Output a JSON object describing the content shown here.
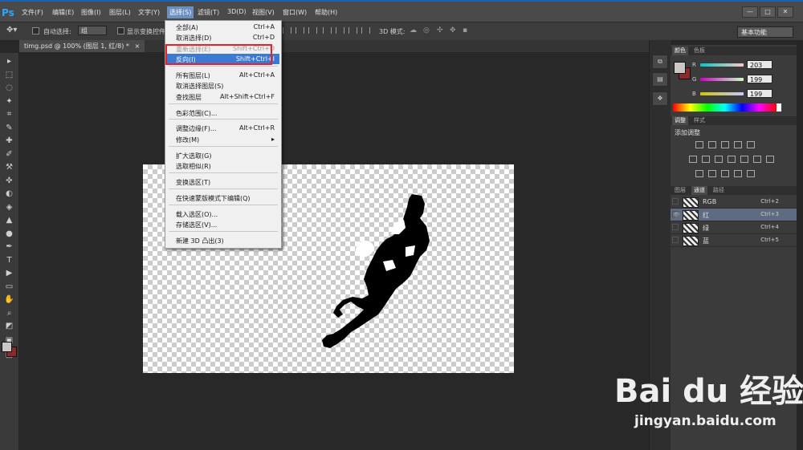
{
  "app": {
    "logo": "Ps"
  },
  "menubar": [
    "文件(F)",
    "编辑(E)",
    "图像(I)",
    "图层(L)",
    "文字(Y)",
    "选择(S)",
    "滤镜(T)",
    "3D(D)",
    "视图(V)",
    "窗口(W)",
    "帮助(H)"
  ],
  "window_controls": {
    "minimize": "—",
    "restore": "□",
    "close": "✕"
  },
  "options_bar": {
    "auto_select_label": "自动选择:",
    "auto_select_value": "组",
    "show_transform_label": "显示变换控件",
    "mode_3d_label": "3D 模式:",
    "workspace": "基本功能"
  },
  "document": {
    "tab_title": "timg.psd @ 100% (图层 1, 红/8) *",
    "tab_close": "×"
  },
  "select_menu": {
    "items": [
      {
        "label": "全部(A)",
        "shortcut": "Ctrl+A",
        "state": "normal"
      },
      {
        "label": "取消选择(D)",
        "shortcut": "Ctrl+D",
        "state": "normal"
      },
      {
        "label": "重新选择(E)",
        "shortcut": "Shift+Ctrl+D",
        "state": "disabled"
      },
      {
        "label": "反向(I)",
        "shortcut": "Shift+Ctrl+I",
        "state": "selected"
      },
      {
        "label": "所有图层(L)",
        "shortcut": "Alt+Ctrl+A",
        "state": "normal"
      },
      {
        "label": "取消选择图层(S)",
        "shortcut": "",
        "state": "normal"
      },
      {
        "label": "查找图层",
        "shortcut": "Alt+Shift+Ctrl+F",
        "state": "normal"
      },
      {
        "label": "色彩范围(C)...",
        "shortcut": "",
        "state": "normal"
      },
      {
        "label": "调整边缘(F)...",
        "shortcut": "Alt+Ctrl+R",
        "state": "normal"
      },
      {
        "label": "修改(M)",
        "shortcut": "▸",
        "state": "normal"
      },
      {
        "label": "扩大选取(G)",
        "shortcut": "",
        "state": "normal"
      },
      {
        "label": "选取相似(R)",
        "shortcut": "",
        "state": "normal"
      },
      {
        "label": "变换选区(T)",
        "shortcut": "",
        "state": "normal"
      },
      {
        "label": "在快速蒙版模式下编辑(Q)",
        "shortcut": "",
        "state": "normal"
      },
      {
        "label": "载入选区(O)...",
        "shortcut": "",
        "state": "normal"
      },
      {
        "label": "存储选区(V)...",
        "shortcut": "",
        "state": "normal"
      },
      {
        "label": "新建 3D 凸出(3)",
        "shortcut": "",
        "state": "normal"
      }
    ]
  },
  "color_panel": {
    "tabs": [
      "颜色",
      "色板"
    ],
    "channels": [
      {
        "label": "R",
        "value": "203"
      },
      {
        "label": "G",
        "value": "199"
      },
      {
        "label": "B",
        "value": "199"
      }
    ]
  },
  "adjust_panel": {
    "tabs": [
      "调整",
      "样式"
    ],
    "title": "添加调整"
  },
  "channels_panel": {
    "tabs": [
      "图层",
      "通道",
      "路径"
    ],
    "rows": [
      {
        "name": "RGB",
        "shortcut": "Ctrl+2",
        "visible": false,
        "selected": false
      },
      {
        "name": "红",
        "shortcut": "Ctrl+3",
        "visible": true,
        "selected": true
      },
      {
        "name": "绿",
        "shortcut": "Ctrl+4",
        "visible": false,
        "selected": false
      },
      {
        "name": "蓝",
        "shortcut": "Ctrl+5",
        "visible": false,
        "selected": false
      }
    ]
  },
  "watermark": {
    "logo": "Bai du 经验",
    "url": "jingyan.baidu.com"
  },
  "colors": {
    "selected_item": "#3c79d3",
    "highlight_border": "#e3242b",
    "accent": "#2aa7ff"
  }
}
